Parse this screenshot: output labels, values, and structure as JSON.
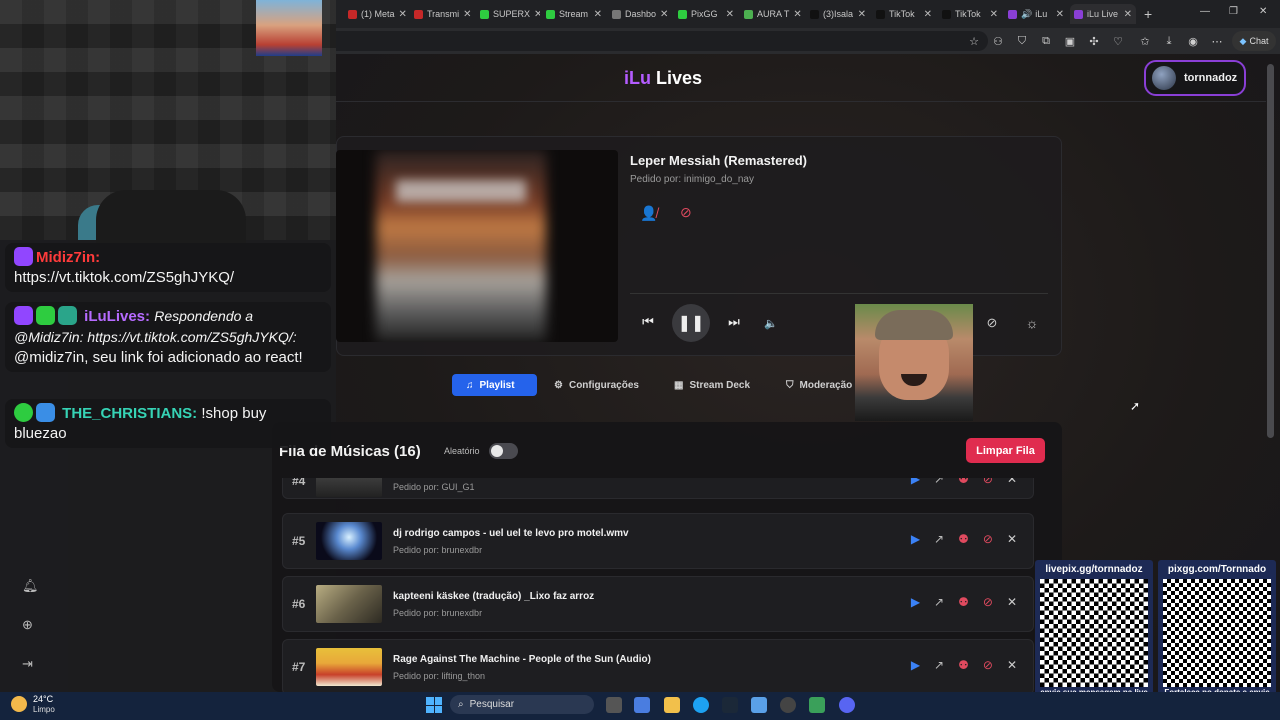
{
  "browser": {
    "tabs": [
      {
        "label": "(1) Meta",
        "color": "#c62828"
      },
      {
        "label": "Transmi",
        "color": "#c62828"
      },
      {
        "label": "SUPERX",
        "color": "#2ecc40"
      },
      {
        "label": "Stream",
        "color": "#2ecc40"
      },
      {
        "label": "Dashbo",
        "color": "#777777"
      },
      {
        "label": "PixGG",
        "color": "#2ecc40"
      },
      {
        "label": "AURA T",
        "color": "#4caf50"
      },
      {
        "label": "(3)Isala",
        "color": "#222222"
      },
      {
        "label": "TikTok",
        "color": "#222222"
      },
      {
        "label": "TikTok",
        "color": "#222222"
      },
      {
        "label": "iLu",
        "color": "#8a3fd6"
      },
      {
        "label": "iLu Live",
        "color": "#8a3fd6"
      }
    ],
    "new_tab": "+",
    "chat_label": "Chat"
  },
  "header": {
    "logo_part1": "iLu",
    "logo_part2": "Lives",
    "username": "tornnadoz"
  },
  "player": {
    "song_title": "Leper Messiah (Remastered)",
    "requested_by": "Pedido por: inimigo_do_nay"
  },
  "nav_tabs": [
    {
      "label": "Playlist",
      "icon": "♫"
    },
    {
      "label": "Configurações",
      "icon": "⚙"
    },
    {
      "label": "Stream Deck",
      "icon": "▦"
    },
    {
      "label": "Moderação",
      "icon": "⛉"
    }
  ],
  "queue": {
    "title": "Fila de Músicas (16)",
    "shuffle_label": "Aleatório",
    "clear_label": "Limpar Fila",
    "items": [
      {
        "num": "#4",
        "title": "",
        "requester": "Pedido por: GUI_G1"
      },
      {
        "num": "#5",
        "title": "dj rodrigo campos - uel uel te levo pro motel.wmv",
        "requester": "Pedido por: brunexdbr"
      },
      {
        "num": "#6",
        "title": "kapteeni käskee (tradução) _Lixo faz arroz",
        "requester": "Pedido por: brunexdbr"
      },
      {
        "num": "#7",
        "title": "Rage Against The Machine - People of the Sun (Audio)",
        "requester": "Pedido por: lifting_thon"
      }
    ]
  },
  "chat": [
    {
      "user": "Midiz7in:",
      "user_color": "#ff3b3b",
      "text": "https://vt.tiktok.com/ZS5ghJYKQ/"
    },
    {
      "user": "iLuLives:",
      "user_color": "#b66bff",
      "reply": "Respondendo a @Midiz7in: https://vt.tiktok.com/ZS5ghJYKQ/:",
      "text": "@midiz7in, seu link foi adicionado ao react!"
    },
    {
      "user": "THE_CHRISTIANS:",
      "user_color": "#36d3b5",
      "text": "!shop buy bluezao"
    }
  ],
  "qr": [
    {
      "header": "livepix.gg/tornnadoz",
      "footer": "envie sua mensagem na live via pix!"
    },
    {
      "header": "pixgg.com/Tornnado",
      "footer": "Fortaleça no donate e envie sua mensagem!"
    }
  ],
  "taskbar": {
    "temperature": "24°C",
    "weather": "Limpo",
    "search_placeholder": "Pesquisar"
  }
}
